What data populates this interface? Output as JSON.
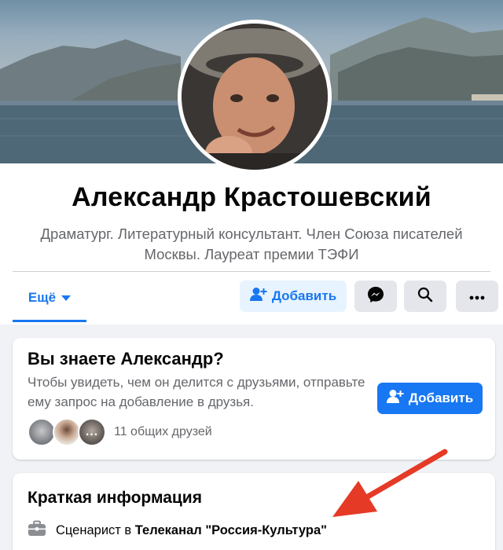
{
  "profile": {
    "name": "Александр Крастошевский",
    "bio": "Драматург. Литературный консультант. Член Союза писателей Москвы. Лауреат премии ТЭФИ"
  },
  "actions": {
    "more_tab_label": "Ещё",
    "add_button_label": "Добавить"
  },
  "know_card": {
    "title": "Вы знаете Александр?",
    "text": "Чтобы увидеть, чем он делится с друзьями, отправьте ему запрос на добавление в друзья.",
    "add_button_label": "Добавить",
    "mutual_more": "...",
    "mutual_friends": "11 общих друзей"
  },
  "info_card": {
    "title": "Краткая информация",
    "work_prefix": "Сценарист в",
    "work_place": "Телеканал \"Россия-Культура\""
  },
  "colors": {
    "accent": "#1877f2",
    "accent_light": "#e7f3ff",
    "annotation_arrow": "#e53a26"
  }
}
